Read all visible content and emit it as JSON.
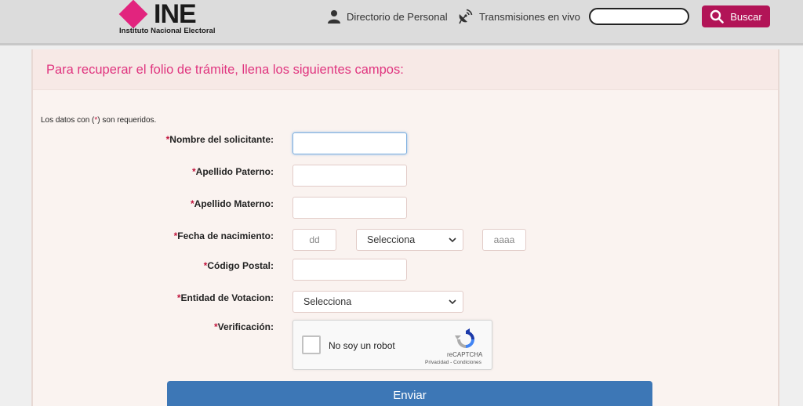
{
  "header": {
    "logo_text": "INE",
    "logo_sub": "Instituto Nacional Electoral",
    "nav": [
      {
        "label": "Directorio de Personal",
        "icon": "person-icon"
      },
      {
        "label": "Transmisiones en vivo",
        "icon": "satellite-icon"
      }
    ],
    "search": {
      "value": "",
      "placeholder": "",
      "button_label": "Buscar"
    },
    "accent_color": "#b21457"
  },
  "form": {
    "title": "Para recuperar el folio de trámite, llena los siguientes campos:",
    "required_note_pre": "Los datos con (",
    "required_note_star": "*",
    "required_note_post": ") son requeridos.",
    "fields": {
      "nombre": {
        "label": "Nombre del solicitante:",
        "value": ""
      },
      "paterno": {
        "label": "Apellido Paterno:",
        "value": ""
      },
      "materno": {
        "label": "Apellido Materno:",
        "value": ""
      },
      "fecha": {
        "label": "Fecha de nacimiento:",
        "day_placeholder": "dd",
        "month_value": "Selecciona",
        "year_placeholder": "aaaa"
      },
      "cp": {
        "label": "Código Postal:",
        "value": ""
      },
      "entidad": {
        "label": "Entidad de Votacion:",
        "value": "Selecciona"
      },
      "verificacion": {
        "label": "Verificación:"
      }
    },
    "captcha": {
      "label": "No soy un robot",
      "brand": "reCAPTCHA",
      "links": "Privacidad - Condiciones"
    },
    "submit_label": "Enviar",
    "title_color": "#e0357f",
    "button_color": "#3d77b6"
  }
}
